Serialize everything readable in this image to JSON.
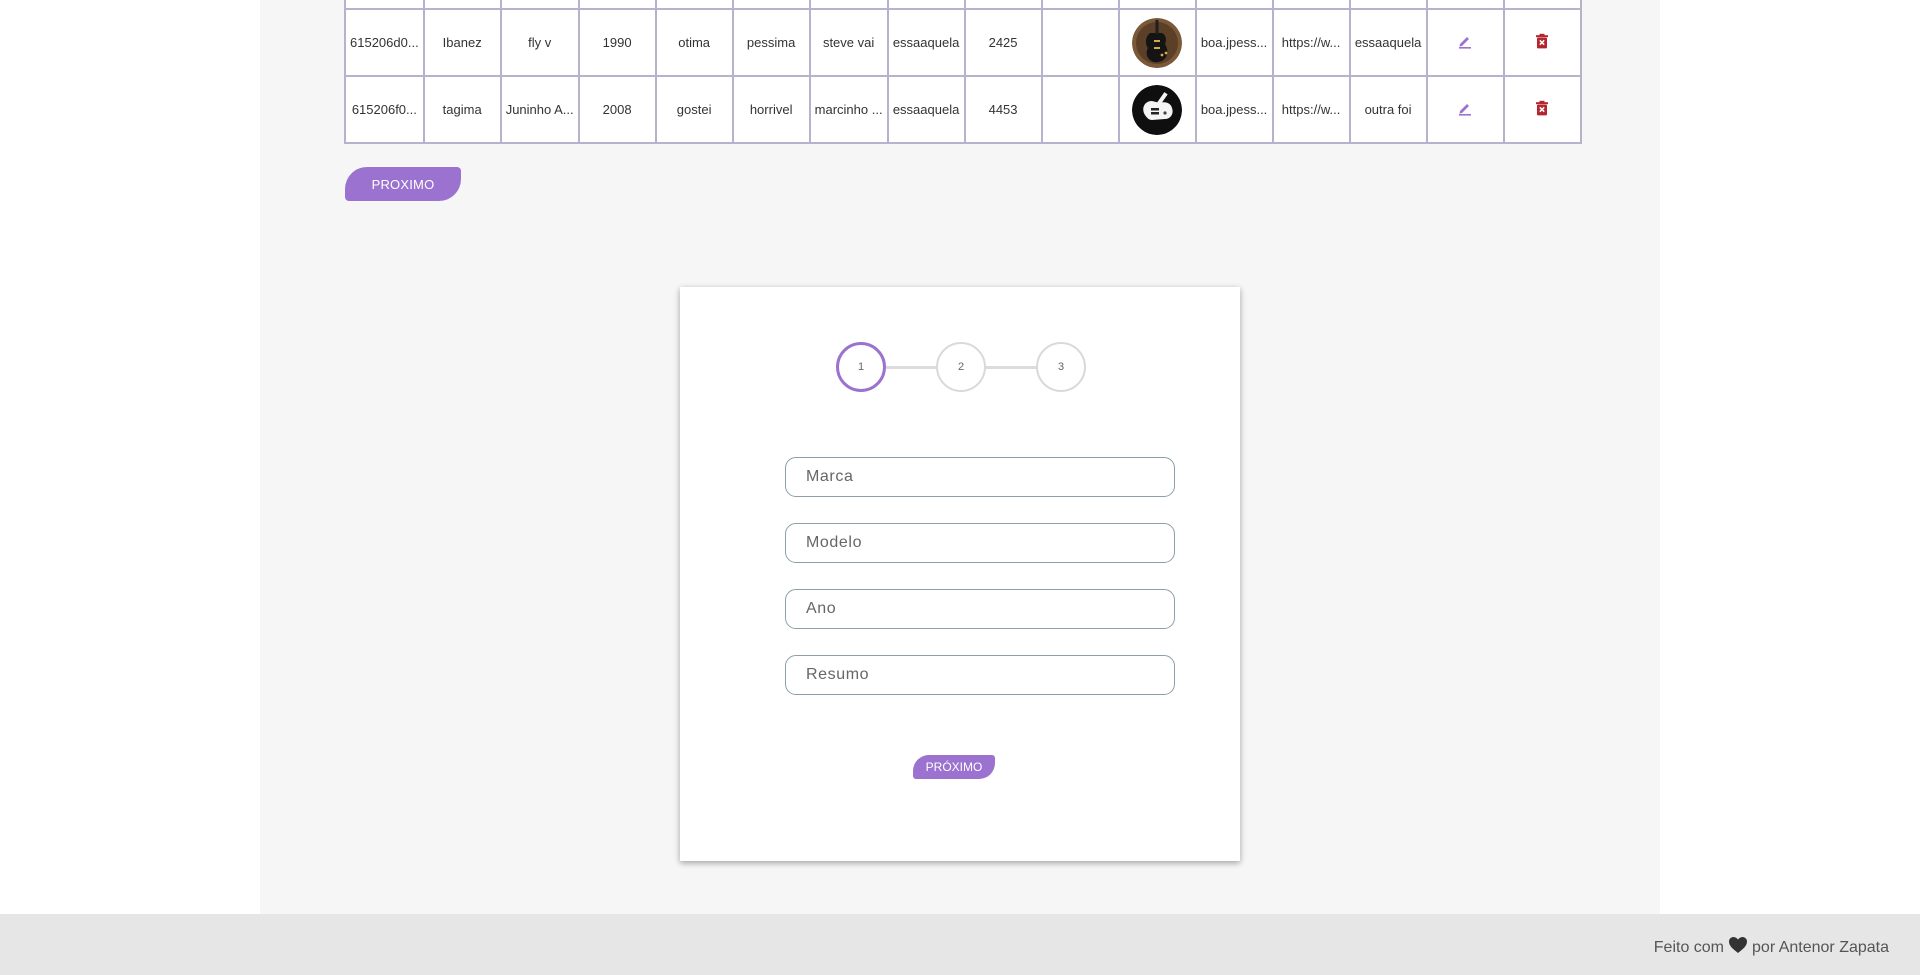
{
  "table": {
    "rows": [
      {
        "id": "615206d0...",
        "marca": "Ibanez",
        "modelo": "fly v",
        "ano": "1990",
        "col5": "otima",
        "col6": "pessima",
        "col7": "steve vai",
        "col8": "essaaquela",
        "col9": "2425",
        "col10": "",
        "image_file": "boa.jpess...",
        "link": "https://w...",
        "col14": "essaaquela"
      },
      {
        "id": "615206f0...",
        "marca": "tagima",
        "modelo": "Juninho A...",
        "ano": "2008",
        "col5": "gostei",
        "col6": "horrivel",
        "col7": "marcinho ...",
        "col8": "essaaquela",
        "col9": "4453",
        "col10": "",
        "image_file": "boa.jpess...",
        "link": "https://w...",
        "col14": "outra foi"
      }
    ],
    "icons": {
      "edit": "pencil-icon",
      "delete": "trash-icon"
    },
    "next_page_label": "PROXIMO"
  },
  "form": {
    "steps": [
      "1",
      "2",
      "3"
    ],
    "active_step": 1,
    "fields": {
      "marca": {
        "placeholder": "Marca",
        "value": ""
      },
      "modelo": {
        "placeholder": "Modelo",
        "value": ""
      },
      "ano": {
        "placeholder": "Ano",
        "value": ""
      },
      "resumo": {
        "placeholder": "Resumo",
        "value": ""
      }
    },
    "submit_label": "PRÓXIMO"
  },
  "footer": {
    "prefix": "Feito com",
    "icon": "heart-icon",
    "suffix": "por Antenor Zapata"
  },
  "colors": {
    "accent": "#9b72cf",
    "delete": "#b3262d",
    "table_border": "#b9b2cc",
    "page_bg": "#f6f6f6",
    "footer_bg": "#e6e6e6"
  }
}
